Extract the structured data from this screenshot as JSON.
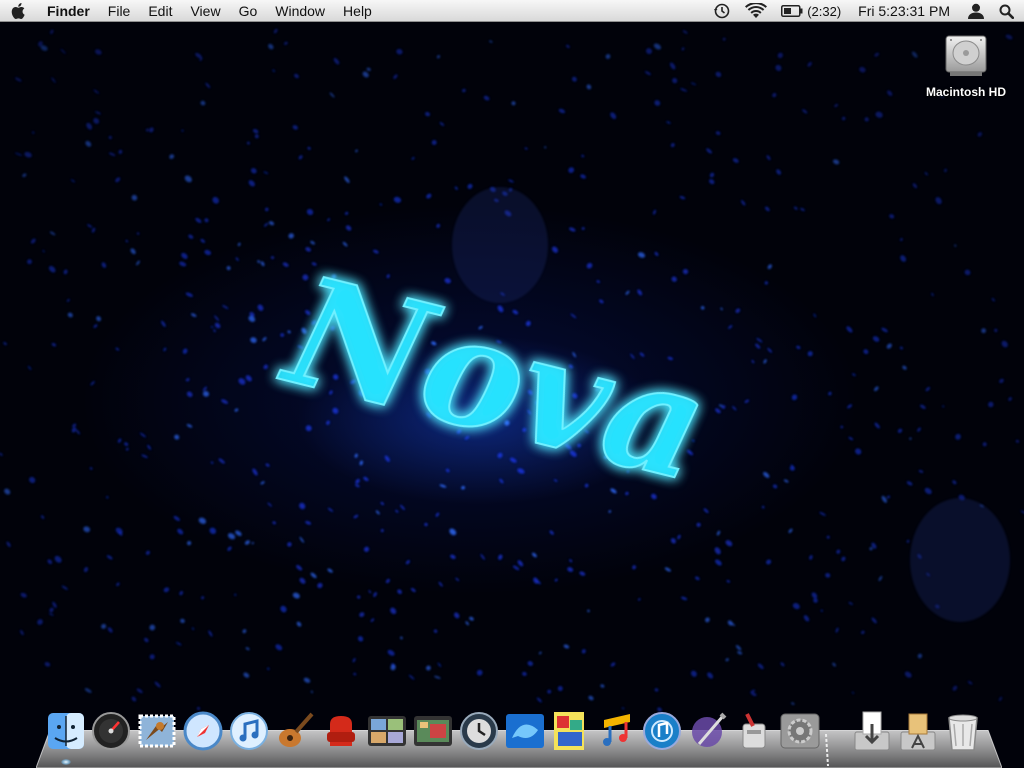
{
  "menubar": {
    "app_name": "Finder",
    "menus": [
      "File",
      "Edit",
      "View",
      "Go",
      "Window",
      "Help"
    ],
    "battery": "(2:32)",
    "clock": "Fri 5:23:31 PM",
    "icons": [
      "apple-icon",
      "time-machine-icon",
      "wifi-icon",
      "battery-icon",
      "user-icon",
      "spotlight-icon"
    ]
  },
  "wallpaper": {
    "text": "Nova",
    "colors": {
      "background": "#01020a",
      "glow": "#27e3ff",
      "drops": "#1a3cff"
    }
  },
  "desktop_icons": [
    {
      "label": "Macintosh HD",
      "icon": "hard-drive-icon"
    }
  ],
  "dock": {
    "items": [
      {
        "name": "Finder",
        "icon": "finder-icon",
        "running": true
      },
      {
        "name": "Dashboard",
        "icon": "dashboard-icon",
        "running": false
      },
      {
        "name": "Mail",
        "icon": "mail-icon",
        "running": false
      },
      {
        "name": "Safari",
        "icon": "safari-icon",
        "running": false
      },
      {
        "name": "iTunes",
        "icon": "itunes-icon",
        "running": false
      },
      {
        "name": "GarageBand",
        "icon": "garageband-icon",
        "running": false
      },
      {
        "name": "Front Row",
        "icon": "front-row-icon",
        "running": false
      },
      {
        "name": "Spaces",
        "icon": "spaces-icon",
        "running": false
      },
      {
        "name": "Photo Booth",
        "icon": "photo-booth-icon",
        "running": false
      },
      {
        "name": "Time Machine",
        "icon": "time-machine-icon",
        "running": false
      },
      {
        "name": "Screen Saver",
        "icon": "screen-saver-icon",
        "running": false
      },
      {
        "name": "Photo Collage",
        "icon": "photo-collage-icon",
        "running": false
      },
      {
        "name": "Music Notes",
        "icon": "music-notes-icon",
        "running": false
      },
      {
        "name": "Audio Player",
        "icon": "audio-player-icon",
        "running": false
      },
      {
        "name": "Script Editor",
        "icon": "script-editor-icon",
        "running": false
      },
      {
        "name": "Automator",
        "icon": "automator-icon",
        "running": false
      },
      {
        "name": "System Preferences",
        "icon": "system-preferences-icon",
        "running": false
      },
      {
        "name": "Downloads",
        "icon": "downloads-stack-icon",
        "running": false
      },
      {
        "name": "Applications",
        "icon": "applications-stack-icon",
        "running": false
      },
      {
        "name": "Trash",
        "icon": "trash-icon",
        "running": false
      }
    ]
  }
}
